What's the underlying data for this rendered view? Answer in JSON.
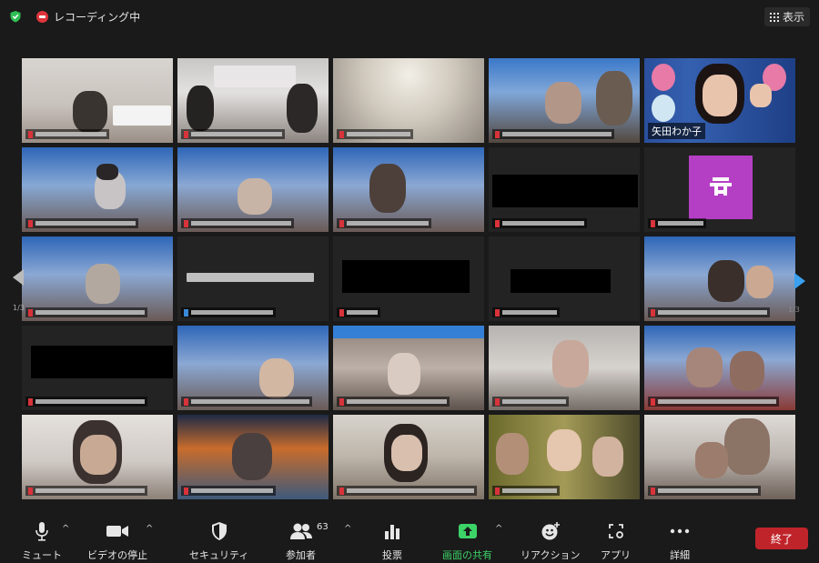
{
  "topbar": {
    "recording_label": "レコーディング中",
    "view_label": "表示"
  },
  "gallery": {
    "active_speaker_name": "矢田わか子",
    "page_left": "1/3",
    "page_right": "1/3"
  },
  "toolbar": {
    "mute_label": "ミュート",
    "video_label": "ビデオの停止",
    "security_label": "セキュリティ",
    "participants_label": "参加者",
    "participants_count": "63",
    "poll_label": "投票",
    "share_label": "画面の共有",
    "reactions_label": "リアクション",
    "apps_label": "アプリ",
    "more_label": "詳細",
    "end_label": "終了"
  },
  "colors": {
    "active_outline": "#e1e34a",
    "share_green": "#3cd367",
    "end_red": "#c0242b",
    "recording_red": "#e0343b"
  }
}
